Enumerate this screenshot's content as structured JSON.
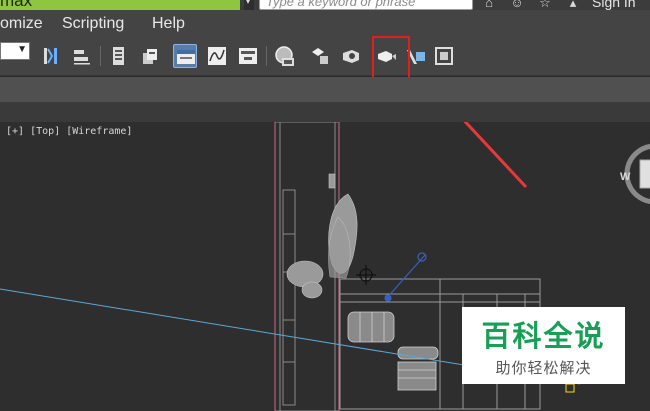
{
  "app": {
    "title_fragment": "max"
  },
  "search": {
    "placeholder": "Type a keyword or phrase"
  },
  "header": {
    "sign_in_label": "Sign In",
    "icons": [
      "home-icon",
      "user-icon",
      "star-icon"
    ]
  },
  "menu": {
    "items": [
      {
        "label": "omize"
      },
      {
        "label": "Scripting"
      },
      {
        "label": "Help"
      }
    ]
  },
  "toolbar": {
    "dropdown_value": "",
    "tools": [
      "select-and-link-icon",
      "align-icon",
      "layer-manager-icon",
      "scene-explorer-icon",
      "toggle-ribbon-icon",
      "curve-editor-icon",
      "schematic-view-icon",
      "material-editor-icon",
      "render-setup-icon",
      "rendered-frame-window-icon",
      "render-production-icon",
      "render-iterative-icon",
      "render-activeshade-icon",
      "render-to-texture-icon"
    ],
    "highlighted_tool": "render-production-icon",
    "highlight_color": "#e02020"
  },
  "viewport": {
    "label": "[+] [Top] [Wireframe]",
    "viewcube_letter": "W",
    "background": "#2e2e2e"
  },
  "watermark": {
    "title": "百科全说",
    "subtitle": "助你轻松解决",
    "color": "#17a055"
  }
}
